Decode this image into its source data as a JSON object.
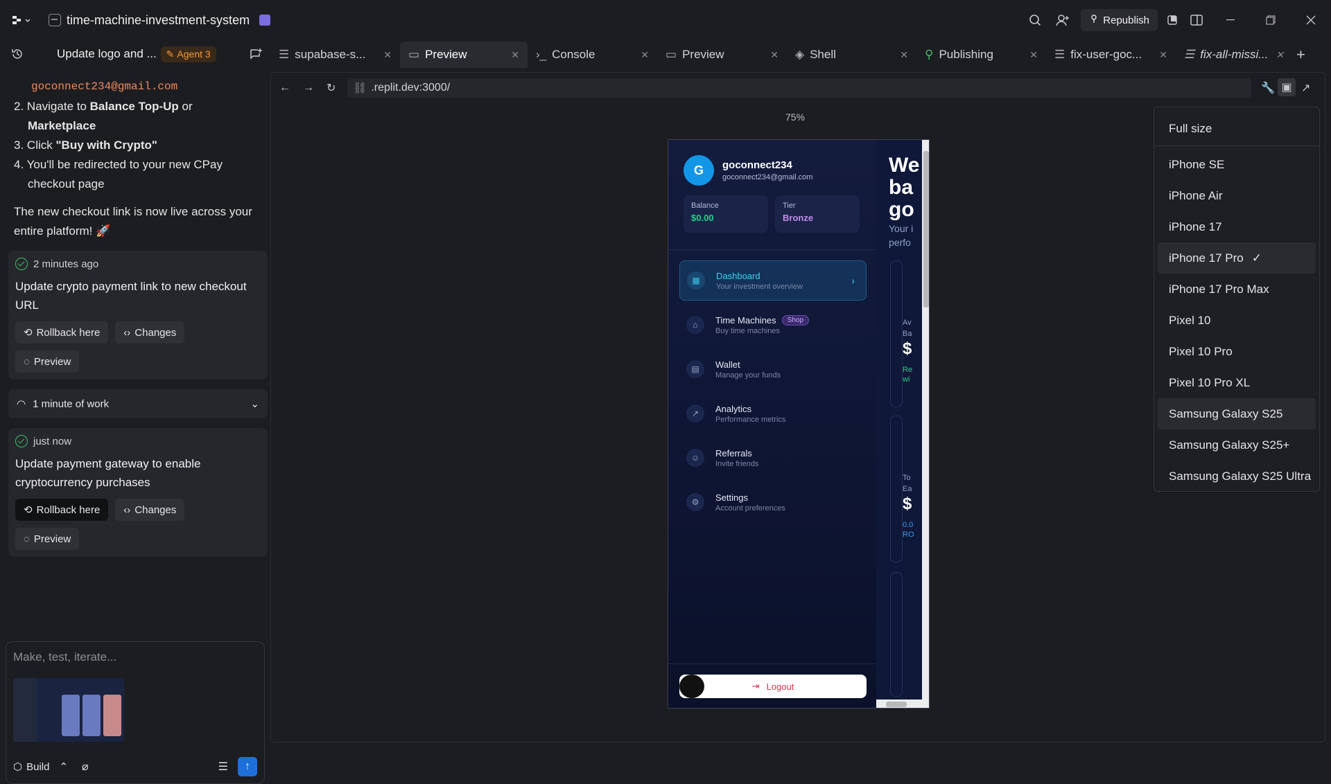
{
  "window": {
    "project_name": "time-machine-investment-system",
    "republish_label": "Republish"
  },
  "left": {
    "header_title": "Update logo and ...",
    "agent_label": "Agent 3",
    "email": "goconnect234@gmail.com",
    "steps": [
      {
        "num": "2.",
        "pre": "Navigate to ",
        "bold1": "Balance Top-Up",
        "mid": " or ",
        "bold2": "Marketplace"
      },
      {
        "num": "3.",
        "pre": "Click ",
        "bold1": "\"Buy with Crypto\""
      },
      {
        "num": "4.",
        "text": "You'll be redirected to your new CPay checkout page"
      }
    ],
    "paragraph": "The new checkout link is now live across your entire platform! 🚀",
    "cards": [
      {
        "time": "2 minutes ago",
        "message": "Update crypto payment link to new checkout URL",
        "rollback": "Rollback here",
        "changes": "Changes",
        "preview": "Preview"
      },
      {
        "time": "just now",
        "message": "Update payment gateway to enable cryptocurrency purchases",
        "rollback": "Rollback here",
        "changes": "Changes",
        "preview": "Preview"
      }
    ],
    "work_label": "1 minute of work",
    "input_placeholder": "Make, test, iterate...",
    "build_label": "Build"
  },
  "tabs": [
    {
      "label": "supabase-s...",
      "icon": "database-icon",
      "active": false
    },
    {
      "label": "Preview",
      "icon": "monitor-icon",
      "active": true
    },
    {
      "label": "Console",
      "icon": "terminal-icon",
      "active": false
    },
    {
      "label": "Preview",
      "icon": "monitor-icon",
      "active": false
    },
    {
      "label": "Shell",
      "icon": "shell-icon",
      "active": false
    },
    {
      "label": "Publishing",
      "icon": "publish-icon",
      "active": false
    },
    {
      "label": "fix-user-goc...",
      "icon": "database-icon",
      "active": false
    },
    {
      "label": "fix-all-missi...",
      "icon": "database-icon",
      "active": false
    }
  ],
  "preview": {
    "url": ".replit.dev:3000/",
    "zoom": "75%",
    "app": {
      "avatar_letter": "G",
      "username": "goconnect234",
      "email": "goconnect234@gmail.com",
      "balance_label": "Balance",
      "balance_value": "$0.00",
      "tier_label": "Tier",
      "tier_value": "Bronze",
      "nav": [
        {
          "title": "Dashboard",
          "sub": "Your investment overview",
          "icon": "grid-icon",
          "active": true
        },
        {
          "title": "Time Machines",
          "sub": "Buy time machines",
          "icon": "store-icon",
          "badge": "Shop"
        },
        {
          "title": "Wallet",
          "sub": "Manage your funds",
          "icon": "wallet-icon"
        },
        {
          "title": "Analytics",
          "sub": "Performance metrics",
          "icon": "trend-icon"
        },
        {
          "title": "Referrals",
          "sub": "Invite friends",
          "icon": "users-icon"
        },
        {
          "title": "Settings",
          "sub": "Account preferences",
          "icon": "gear-icon"
        }
      ],
      "logout_label": "Logout",
      "main_fragments": [
        "We",
        "ba",
        "go",
        "Your i",
        "perfo",
        "Av",
        "Ba",
        "$",
        "Re",
        "wi",
        "To",
        "Ea",
        "$",
        "0.0",
        "RO"
      ]
    }
  },
  "device_menu": {
    "items": [
      "Full size",
      "iPhone SE",
      "iPhone Air",
      "iPhone 17",
      "iPhone 17 Pro",
      "iPhone 17 Pro Max",
      "Pixel 10",
      "Pixel 10 Pro",
      "Pixel 10 Pro XL",
      "Samsung Galaxy S25",
      "Samsung Galaxy S25+",
      "Samsung Galaxy S25 Ultra"
    ],
    "selected": "iPhone 17 Pro"
  },
  "colors": {
    "accent": "#1e6fd9",
    "agent": "#f29a3c",
    "success": "#3fbf6a",
    "balance": "#22d38a",
    "tier": "#c38cf0",
    "active_nav": "#3ad0ee",
    "logout": "#e0344a"
  }
}
